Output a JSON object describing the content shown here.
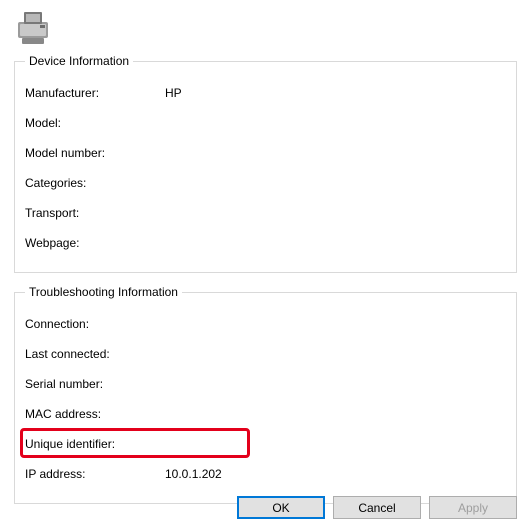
{
  "groups": {
    "device": {
      "legend": "Device Information",
      "rows": {
        "manufacturer": {
          "label": "Manufacturer:",
          "value": "HP"
        },
        "model": {
          "label": "Model:",
          "value": ""
        },
        "model_number": {
          "label": "Model number:",
          "value": ""
        },
        "categories": {
          "label": "Categories:",
          "value": ""
        },
        "transport": {
          "label": "Transport:",
          "value": ""
        },
        "webpage": {
          "label": "Webpage:",
          "value": ""
        }
      }
    },
    "troubleshooting": {
      "legend": "Troubleshooting Information",
      "rows": {
        "connection": {
          "label": "Connection:",
          "value": ""
        },
        "last_connected": {
          "label": "Last connected:",
          "value": ""
        },
        "serial_number": {
          "label": "Serial number:",
          "value": ""
        },
        "mac_address": {
          "label": "MAC address:",
          "value": ""
        },
        "unique_id": {
          "label": "Unique identifier:",
          "value": ""
        },
        "ip_address": {
          "label": "IP address:",
          "value": "10.0.1.202"
        }
      }
    }
  },
  "buttons": {
    "ok": "OK",
    "cancel": "Cancel",
    "apply": "Apply"
  }
}
